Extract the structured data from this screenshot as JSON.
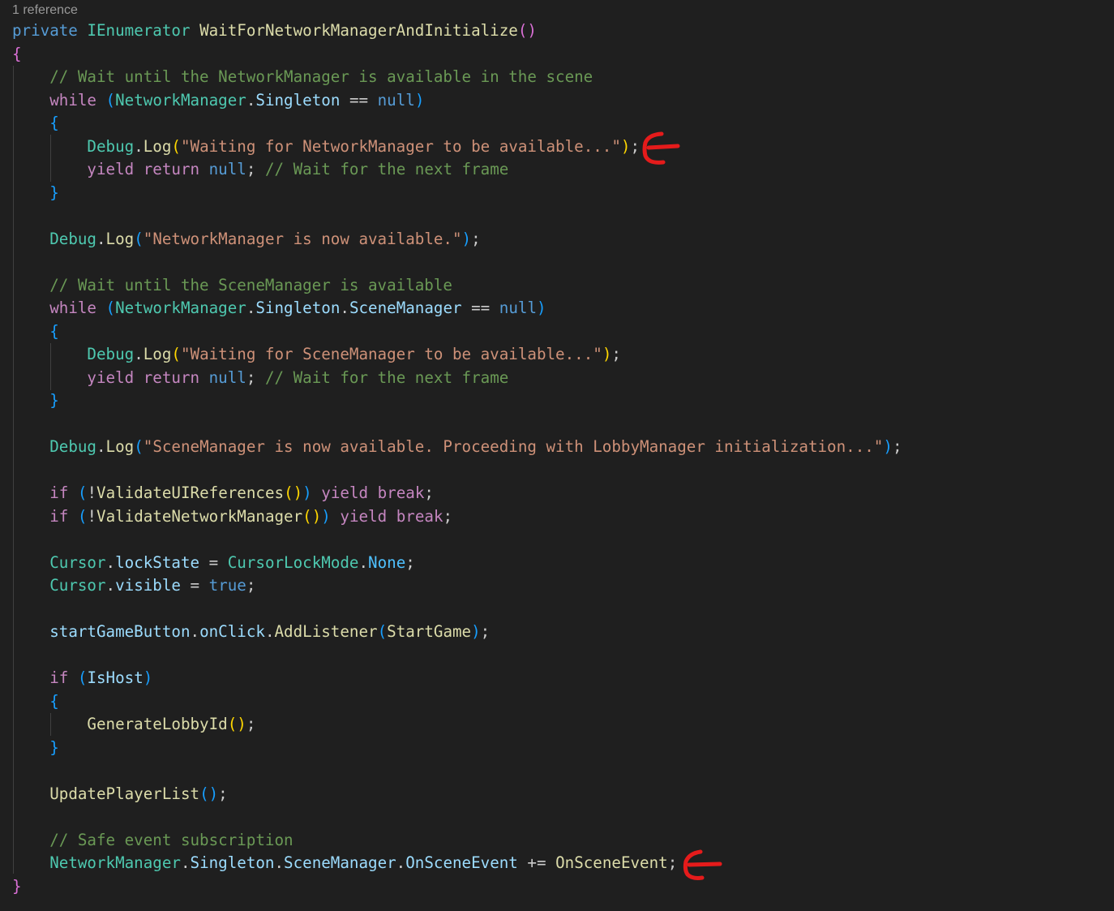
{
  "codelens": {
    "references": "1 reference"
  },
  "code": {
    "private": "private",
    "ienumerator": "IEnumerator",
    "method_name": "WaitForNetworkManagerAndInitialize",
    "comment_wait_nm": "// Wait until the NetworkManager is available in the scene",
    "comment_wait_sm": "// Wait until the SceneManager is available",
    "comment_next_frame": "// Wait for the next frame",
    "comment_safe": "// Safe event subscription",
    "kw_while": "while",
    "kw_yield": "yield",
    "kw_return": "return",
    "kw_break": "break",
    "kw_if": "if",
    "kw_null": "null",
    "kw_true": "true",
    "NetworkManager": "NetworkManager",
    "Singleton": "Singleton",
    "SceneManager": "SceneManager",
    "Debug": "Debug",
    "Log": "Log",
    "str_waiting_nm": "\"Waiting for NetworkManager to be available...\"",
    "str_nm_available": "\"NetworkManager is now available.\"",
    "str_waiting_sm": "\"Waiting for SceneManager to be available...\"",
    "str_sm_available": "\"SceneManager is now available. Proceeding with LobbyManager initialization...\"",
    "ValidateUIReferences": "ValidateUIReferences",
    "ValidateNetworkManager": "ValidateNetworkManager",
    "Cursor": "Cursor",
    "lockState": "lockState",
    "CursorLockMode": "CursorLockMode",
    "None": "None",
    "visible": "visible",
    "startGameButton": "startGameButton",
    "onClick": "onClick",
    "AddListener": "AddListener",
    "StartGame": "StartGame",
    "IsHost": "IsHost",
    "GenerateLobbyId": "GenerateLobbyId",
    "UpdatePlayerList": "UpdatePlayerList",
    "OnSceneEvent": "OnSceneEvent"
  },
  "colors": {
    "background": "#1f1f1f",
    "annotation_arrow": "#e51b1b"
  },
  "icons": {
    "annotation_arrow_1": "red-arrow-icon",
    "annotation_arrow_2": "red-arrow-icon"
  }
}
